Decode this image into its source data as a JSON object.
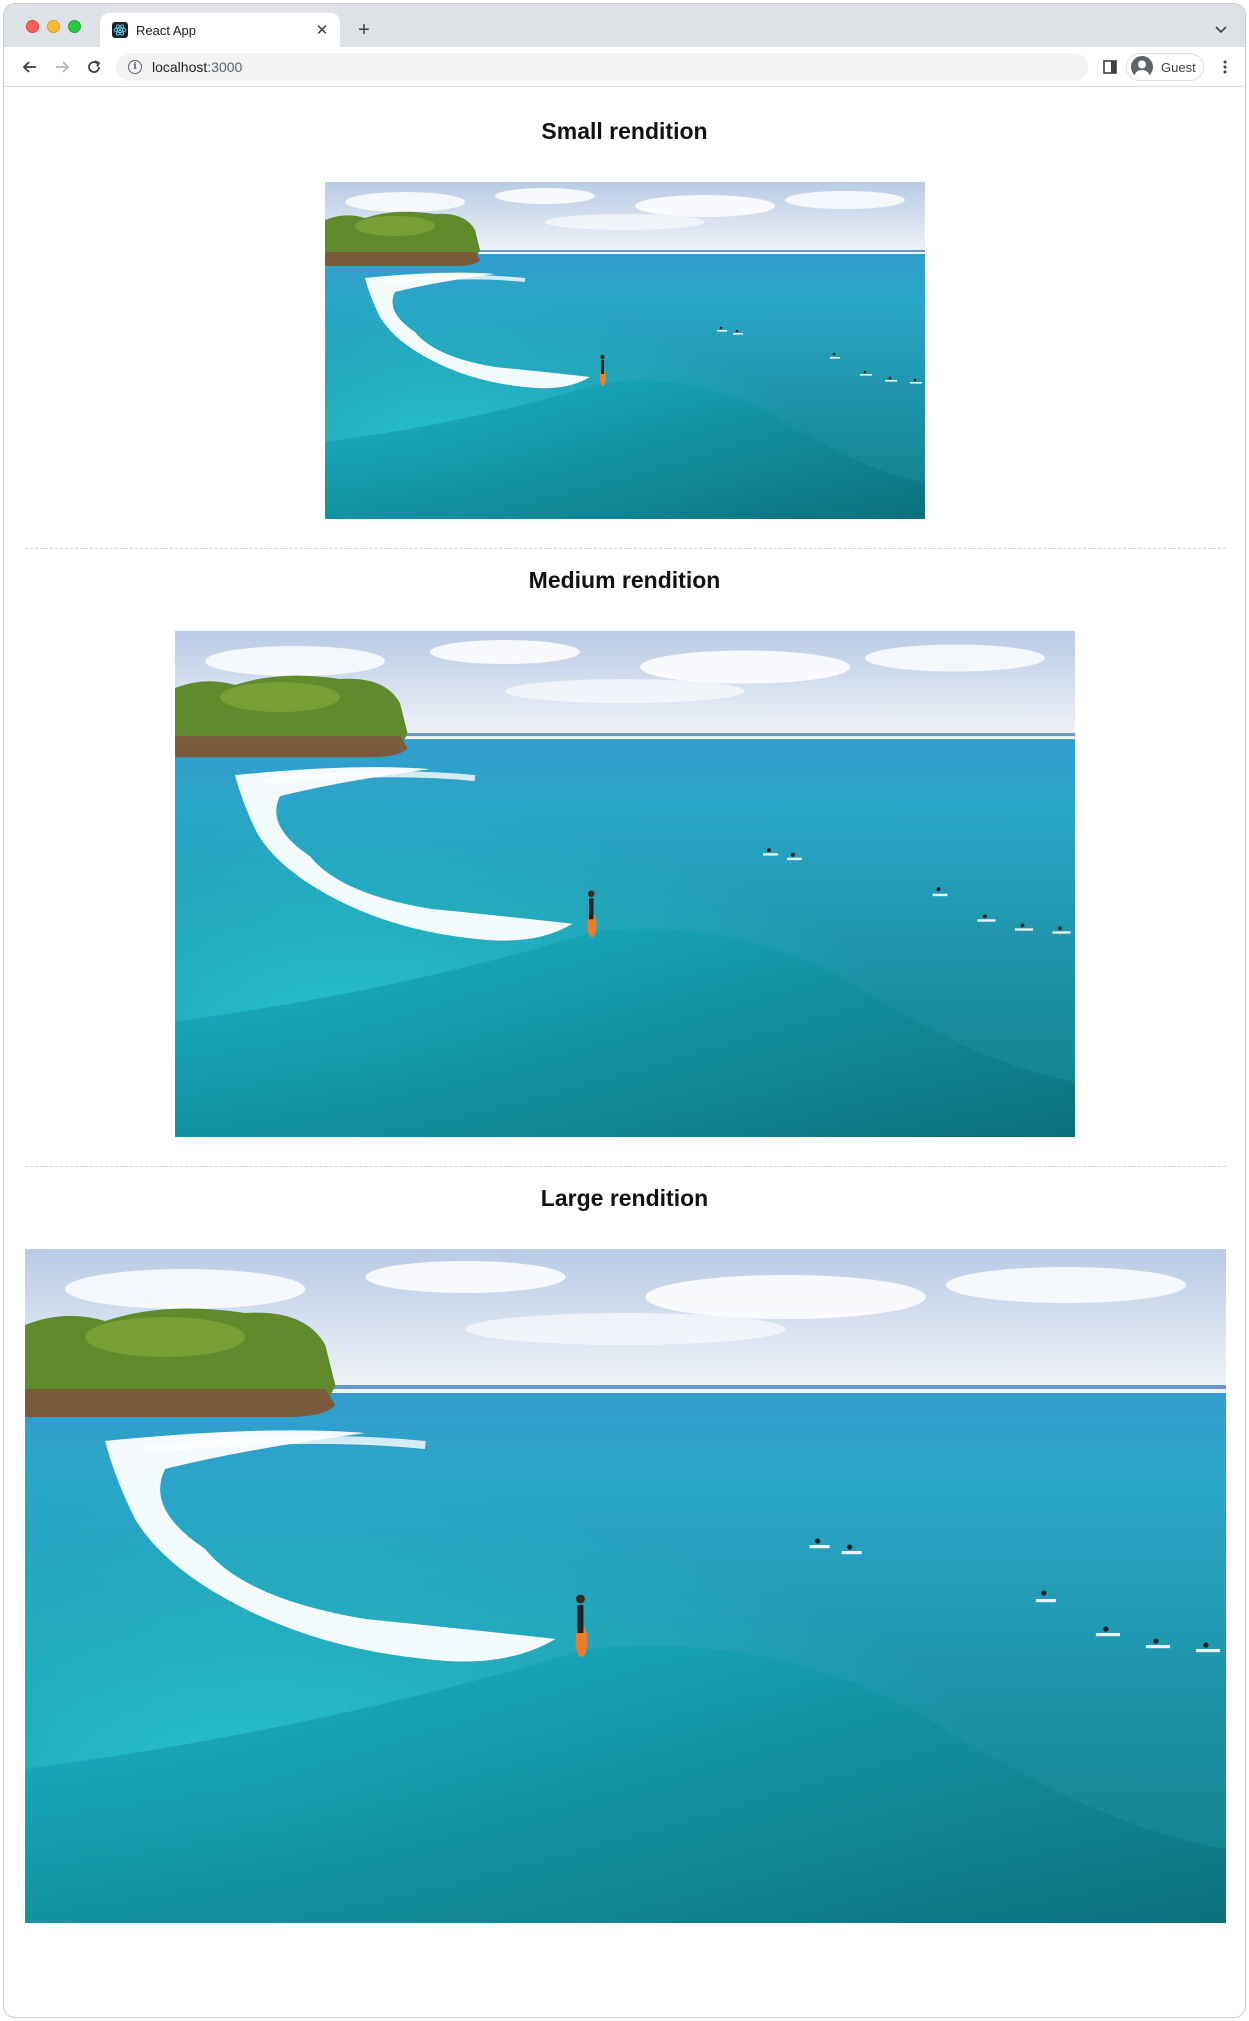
{
  "browser": {
    "tab_title": "React App",
    "url_host": "localhost",
    "url_port": ":3000",
    "profile_label": "Guest"
  },
  "sections": [
    {
      "title": "Small rendition",
      "image": "surfer-wave-photo"
    },
    {
      "title": "Medium rendition",
      "image": "surfer-wave-photo"
    },
    {
      "title": "Large rendition",
      "image": "surfer-wave-photo"
    }
  ],
  "colors": {
    "sky": "#e9eef6",
    "ocean": "#1ea3c2",
    "deep_water": "#0e7a86",
    "island": "#5c8a2a"
  }
}
